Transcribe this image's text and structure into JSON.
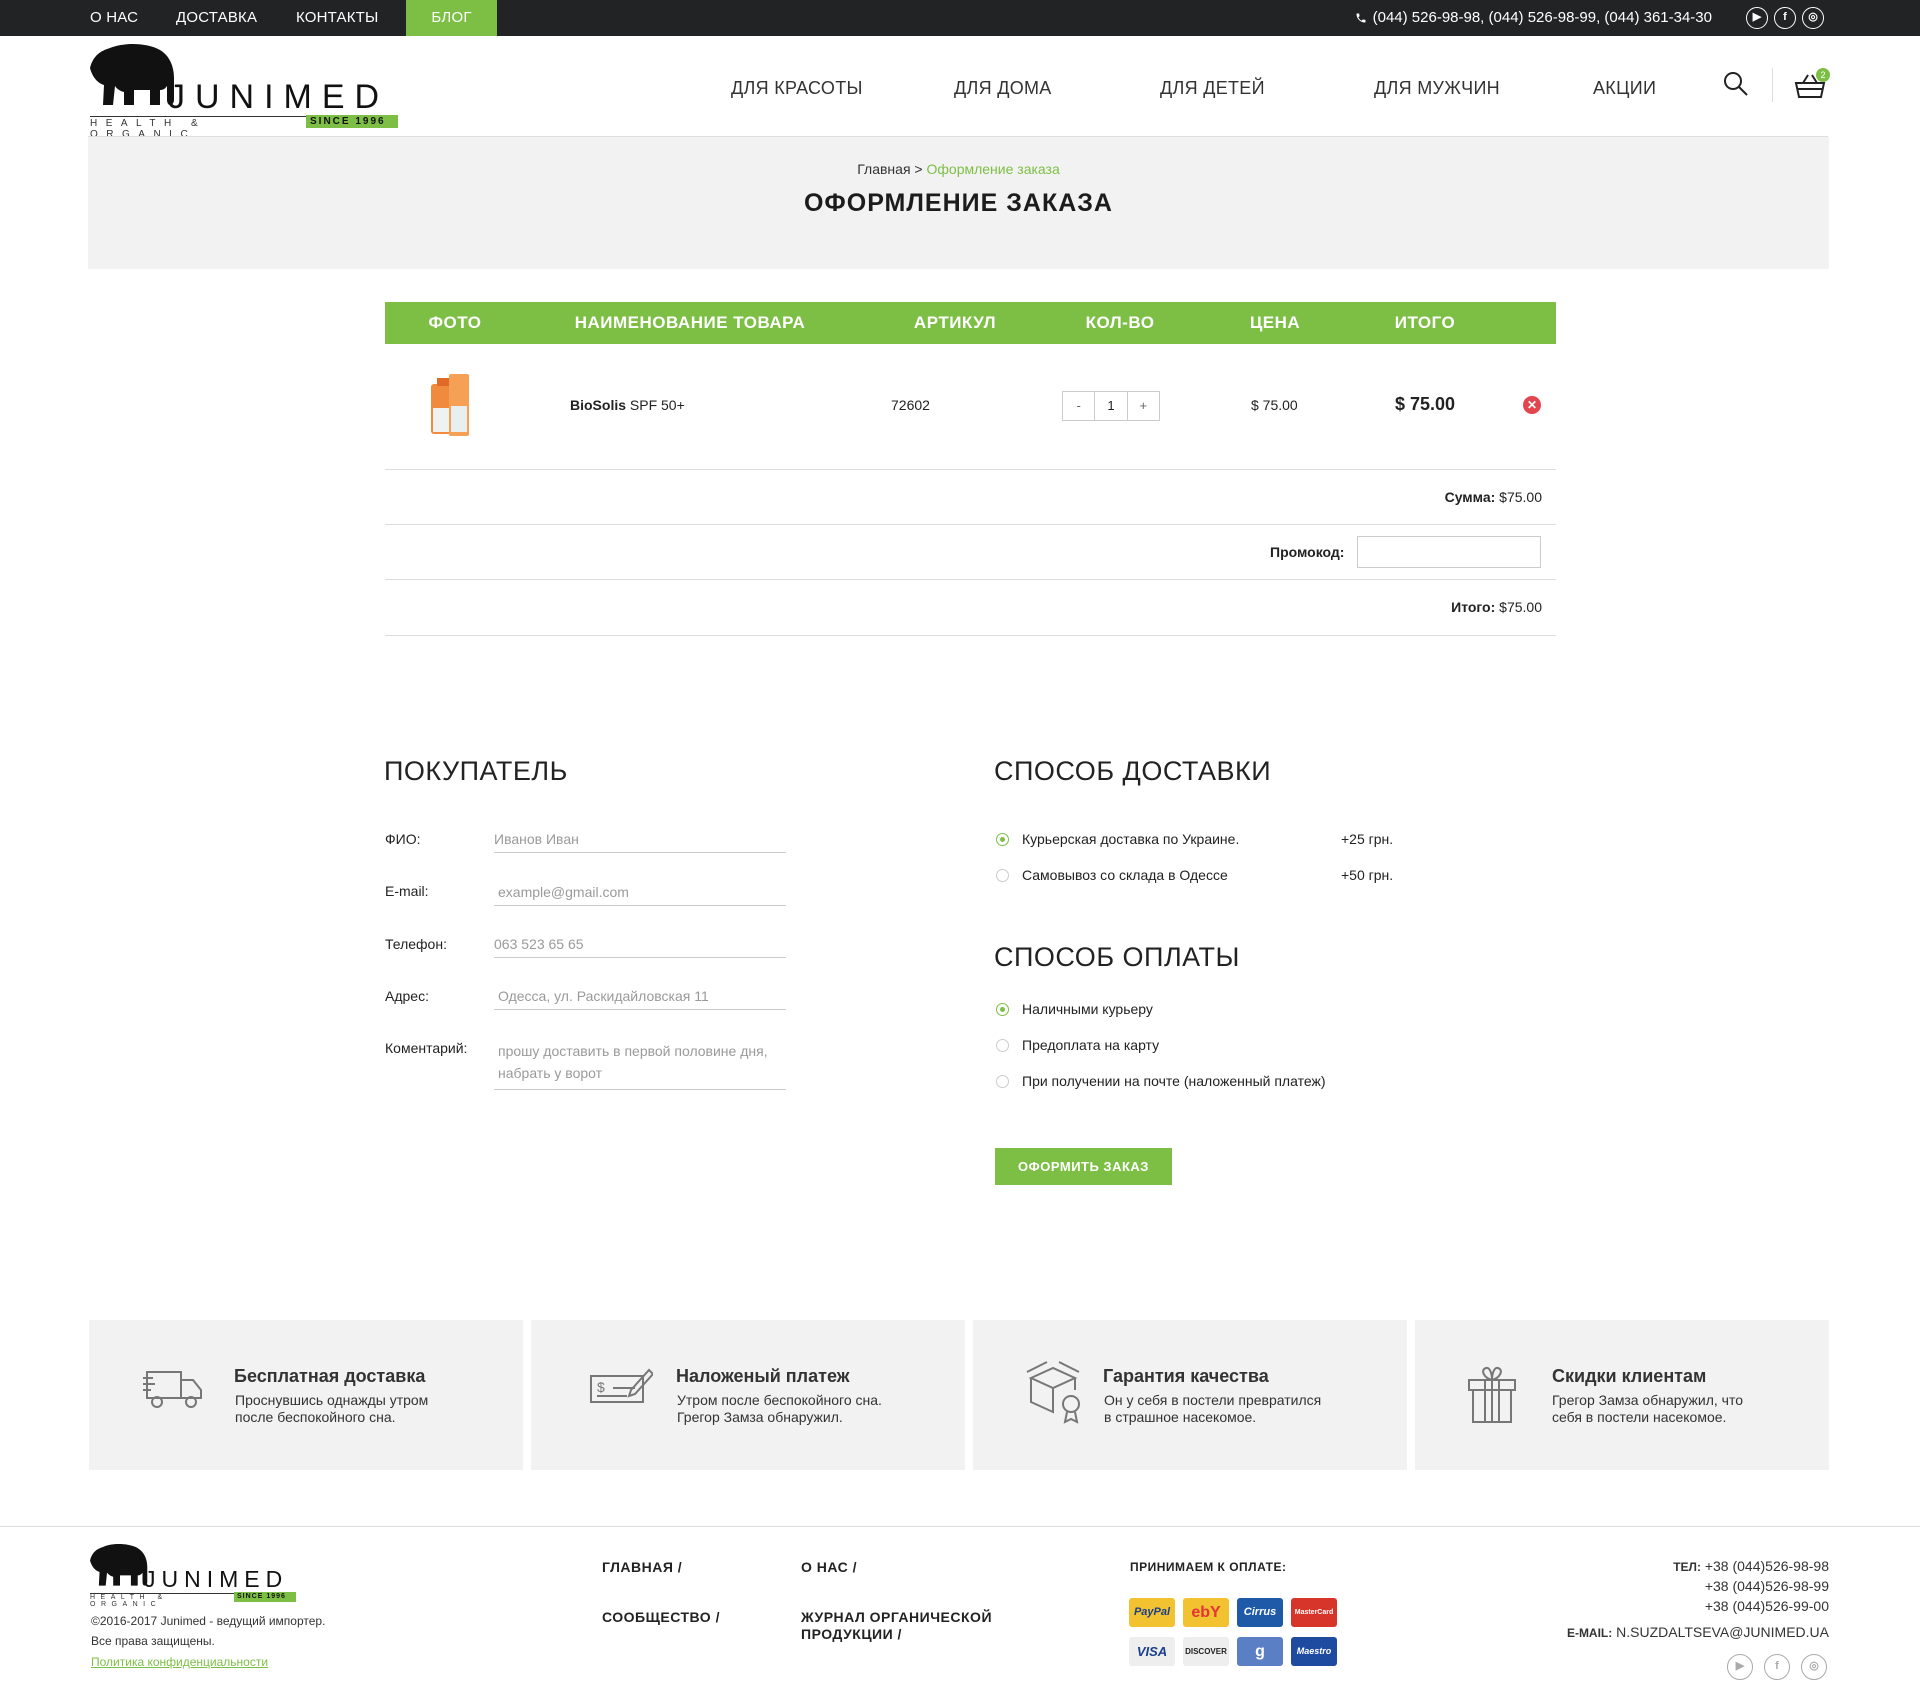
{
  "topbar": {
    "nav": [
      "О НАС",
      "ДОСТАВКА",
      "КОНТАКТЫ",
      "БЛОГ"
    ],
    "phones": "(044) 526-98-98, (044) 526-98-99, (044) 361-34-30",
    "social": [
      "youtube-icon",
      "facebook-icon",
      "instagram-icon"
    ]
  },
  "logo": {
    "word": "JUNIMED",
    "tagline": "HEALTH & ORGANIC",
    "since": "SINCE 1996"
  },
  "mainnav": [
    "ДЛЯ КРАСОТЫ",
    "ДЛЯ ДОМА",
    "ДЛЯ ДЕТЕЙ",
    "ДЛЯ МУЖЧИН",
    "АКЦИИ"
  ],
  "cart": {
    "count": "2"
  },
  "breadcrumb": {
    "home": "Главная",
    "sep": ">",
    "current": "Оформление заказа"
  },
  "page_title": "ОФОРМЛЕНИЕ ЗАКАЗА",
  "table": {
    "headers": [
      "ФОТО",
      "НАИМЕНОВАНИЕ ТОВАРА",
      "АРТИКУЛ",
      "КОЛ-ВО",
      "ЦЕНА",
      "ИТОГО"
    ],
    "item": {
      "brand": "BioSolis",
      "name": " SPF 50+",
      "sku": "72602",
      "qty": "1",
      "minus": "-",
      "plus": "+",
      "price": "$ 75.00",
      "total": "$ 75.00"
    }
  },
  "summary": {
    "sum_label": "Сумма:",
    "sum_value": "$75.00",
    "promo_label": "Промокод:",
    "total_label": "Итого:",
    "total_value": "$75.00"
  },
  "buyer": {
    "title": "ПОКУПАТЕЛЬ",
    "fields": [
      {
        "label": "ФИО:",
        "placeholder": "Иванов Иван"
      },
      {
        "label": "E-mail:",
        "placeholder": "example@gmail.com"
      },
      {
        "label": "Телефон:",
        "placeholder": "063 523 65 65"
      },
      {
        "label": "Адрес:",
        "placeholder": "Одесса, ул. Раскидайловская 11"
      },
      {
        "label": "Коментарий:",
        "placeholder": "прошу доставить в первой половине дня, набрать у ворот"
      }
    ]
  },
  "delivery": {
    "title": "СПОСОБ ДОСТАВКИ",
    "options": [
      {
        "label": "Курьерская доставка по Украине.",
        "price": "+25 грн.",
        "selected": true
      },
      {
        "label": "Самовывоз со склада в Одессе",
        "price": "+50 грн.",
        "selected": false
      }
    ]
  },
  "payment": {
    "title": "СПОСОБ ОПЛАТЫ",
    "options": [
      {
        "label": "Наличными курьеру",
        "selected": true
      },
      {
        "label": "Предоплата на карту",
        "selected": false
      },
      {
        "label": "При получении на почте (наложенный платеж)",
        "selected": false
      }
    ]
  },
  "submit_label": "ОФОРМИТЬ ЗАКАЗ",
  "features": [
    {
      "icon": "truck-icon",
      "title": "Бесплатная доставка",
      "text1": "Проснувшись однажды утром",
      "text2": "после беспокойного сна."
    },
    {
      "icon": "check-payment-icon",
      "title": "Наложеный платеж",
      "text1": "Утром после беспокойного сна.",
      "text2": "Грегор Замза обнаружил."
    },
    {
      "icon": "quality-box-icon",
      "title": "Гарантия качества",
      "text1": "Он у себя в постели превратился",
      "text2": "в страшное насекомое."
    },
    {
      "icon": "gift-icon",
      "title": "Скидки клиентам",
      "text1": "Грегор Замза обнаружил, что",
      "text2": "себя в постели насекомое."
    }
  ],
  "footer": {
    "copy1": "©2016-2017 Junimed - ведущий импортер.",
    "copy2": "Все права защищены.",
    "privacy": "Политика конфиденциальности",
    "links": [
      "ГЛАВНАЯ /",
      "СООБЩЕСТВО /",
      "О НАС /",
      "ЖУРНАЛ ОРГАНИЧЕСКОЙ",
      "ПРОДУКЦИИ /"
    ],
    "pay_title": "ПРИНИМАЕМ К ОПЛАТЕ:",
    "pay_methods": [
      "PayPal",
      "ebY",
      "Cirrus",
      "MasterCard",
      "VISA",
      "DISCOVER",
      "g",
      "Maestro"
    ],
    "tel_label": "ТЕЛ:",
    "tels": [
      "+38 (044)526-98-98",
      "+38 (044)526-98-99",
      "+38 (044)526-99-00"
    ],
    "email_label": "E-MAIL:",
    "email": "N.SUZDALTSEVA@JUNIMED.UA"
  },
  "colors": {
    "accent": "#7dbf45",
    "topbar": "#222325",
    "remove": "#e3464f"
  }
}
